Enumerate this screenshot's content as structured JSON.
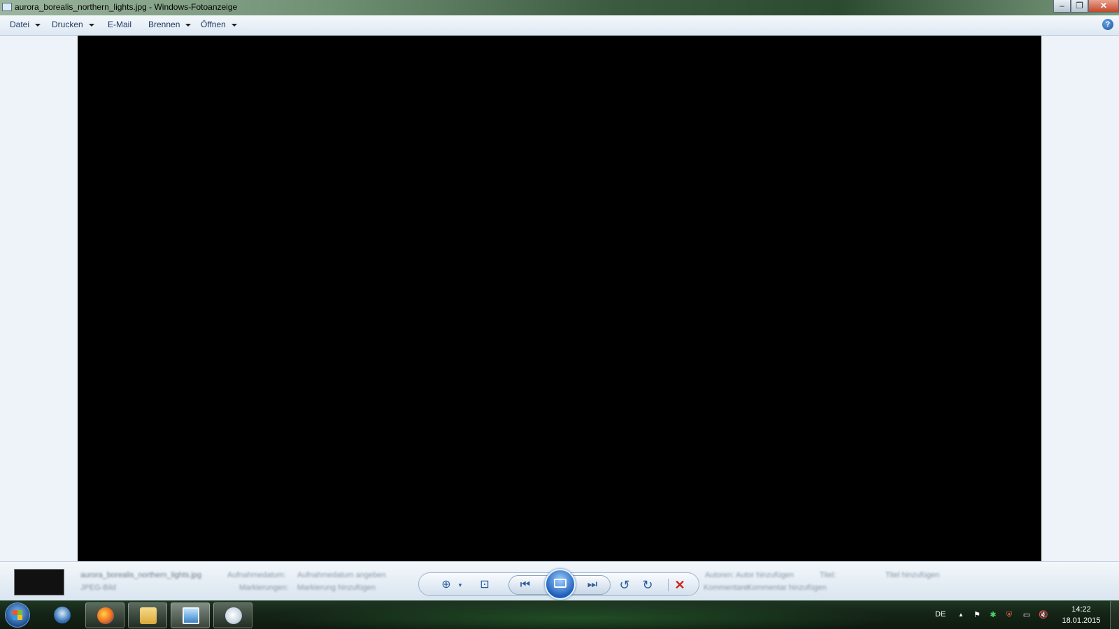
{
  "window": {
    "title": "aurora_borealis_northern_lights.jpg - Windows-Fotoanzeige",
    "minimize": "–",
    "maximize": "❐",
    "close": "✕"
  },
  "menu": {
    "items": [
      "Datei",
      "Drucken",
      "E-Mail",
      "Brennen",
      "Öffnen"
    ],
    "help": "?"
  },
  "info_panel": {
    "filename": "aurora_borealis_northern_lights.jpg",
    "date_taken_label": "Aufnahmedatum:",
    "date_taken_value": "Aufnahmedatum angeben",
    "file_type": "JPEG-Bild",
    "tags_label": "Markierungen:",
    "tags_value": "Markierung hinzufügen",
    "authors_label": "Autoren:",
    "authors_value": "Autor hinzufügen",
    "comments_label": "Kommentare:",
    "comments_value": "Kommentar hinzufügen",
    "title_label": "Titel:",
    "title_value": "Titel hinzufügen"
  },
  "controls": {
    "zoom": "⊕",
    "fit": "⊡",
    "prev": "⏮",
    "next": "⏭",
    "rotate_ccw": "↺",
    "rotate_cw": "↻",
    "delete": "✕"
  },
  "taskbar": {
    "language": "DE",
    "time": "14:22",
    "date": "18.01.2015",
    "tray_up": "▲",
    "tray_flag": "⚑",
    "tray_volume": "🔇"
  }
}
